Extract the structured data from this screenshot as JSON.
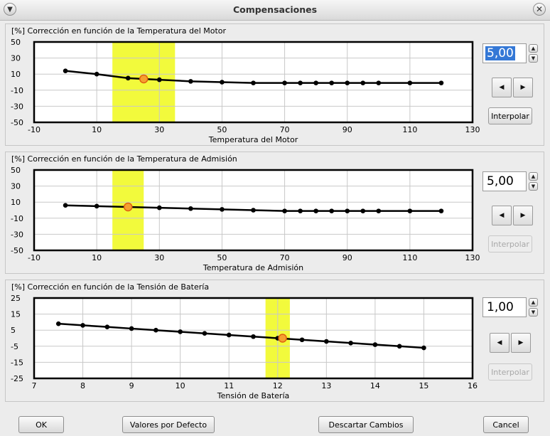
{
  "window": {
    "title": "Compensaciones"
  },
  "panels": [
    {
      "title": "[%] Corrección en función de la Temperatura del Motor",
      "xlabel": "Temperatura del Motor",
      "spin_value": "5,00",
      "spin_selected": true,
      "interpolate_label": "Interpolar",
      "interpolate_enabled": true
    },
    {
      "title": "[%] Corrección en función de la Temperatura de Admisión",
      "xlabel": "Temperatura de Admisión",
      "spin_value": "5,00",
      "spin_selected": false,
      "interpolate_label": "Interpolar",
      "interpolate_enabled": false
    },
    {
      "title": "[%] Corrección en función de la Tensión de Batería",
      "xlabel": "Tensión de Batería",
      "spin_value": "1,00",
      "spin_selected": false,
      "interpolate_label": "Interpolar",
      "interpolate_enabled": false
    }
  ],
  "chart_data": [
    {
      "type": "line",
      "title": "[%] Corrección en función de la Temperatura del Motor",
      "xlabel": "Temperatura del Motor",
      "xlim": [
        -10,
        130
      ],
      "ylim": [
        -50,
        50
      ],
      "xticks": [
        -10,
        10,
        30,
        50,
        70,
        90,
        110,
        130
      ],
      "yticks": [
        50,
        30,
        10,
        -10,
        -30,
        -50
      ],
      "grid": true,
      "x": [
        0,
        10,
        20,
        30,
        40,
        50,
        60,
        70,
        75,
        80,
        85,
        90,
        95,
        100,
        110,
        120
      ],
      "y": [
        14,
        10,
        5,
        3,
        1,
        0,
        -1,
        -1,
        -1,
        -1,
        -1,
        -1,
        -1,
        -1,
        -1,
        -1
      ],
      "highlight_band": [
        15,
        35
      ],
      "marker": {
        "x": 25,
        "y": 4
      },
      "highlight_color": "#f2fa3c",
      "marker_color": "#f5a030"
    },
    {
      "type": "line",
      "title": "[%] Corrección en función de la Temperatura de Admisión",
      "xlabel": "Temperatura de Admisión",
      "xlim": [
        -10,
        130
      ],
      "ylim": [
        -50,
        50
      ],
      "xticks": [
        -10,
        10,
        30,
        50,
        70,
        90,
        110,
        130
      ],
      "yticks": [
        50,
        30,
        10,
        -10,
        -30,
        -50
      ],
      "grid": true,
      "x": [
        0,
        10,
        20,
        30,
        40,
        50,
        60,
        70,
        75,
        80,
        85,
        90,
        95,
        100,
        110,
        120
      ],
      "y": [
        6,
        5,
        4,
        3,
        2,
        1,
        0,
        -1,
        -1,
        -1,
        -1,
        -1,
        -1,
        -1,
        -1,
        -1
      ],
      "highlight_band": [
        15,
        25
      ],
      "marker": {
        "x": 20,
        "y": 4
      },
      "highlight_color": "#f2fa3c",
      "marker_color": "#f5a030"
    },
    {
      "type": "line",
      "title": "[%] Corrección en función de la Tensión de Batería",
      "xlabel": "Tensión de Batería",
      "xlim": [
        7,
        16
      ],
      "ylim": [
        -25,
        25
      ],
      "xticks": [
        7,
        8,
        9,
        10,
        11,
        12,
        13,
        14,
        15,
        16
      ],
      "yticks": [
        25,
        15,
        5,
        -5,
        -15,
        -25
      ],
      "grid": true,
      "x": [
        7.5,
        8,
        8.5,
        9,
        9.5,
        10,
        10.5,
        11,
        11.5,
        12,
        12.5,
        13,
        13.5,
        14,
        14.5,
        15
      ],
      "y": [
        9,
        8,
        7,
        6,
        5,
        4,
        3,
        2,
        1,
        0,
        -1,
        -2,
        -3,
        -4,
        -5,
        -6
      ],
      "highlight_band": [
        11.75,
        12.25
      ],
      "marker": {
        "x": 12.1,
        "y": 0
      },
      "highlight_color": "#f2fa3c",
      "marker_color": "#f5a030"
    }
  ],
  "buttons": {
    "ok": "OK",
    "defaults": "Valores por Defecto",
    "discard": "Descartar Cambios",
    "cancel": "Cancel"
  },
  "icons": {
    "menu": "chevron-down-icon",
    "close": "close-icon",
    "up": "triangle-up-icon",
    "down": "triangle-down-icon",
    "left": "triangle-left-icon",
    "right": "triangle-right-icon"
  }
}
